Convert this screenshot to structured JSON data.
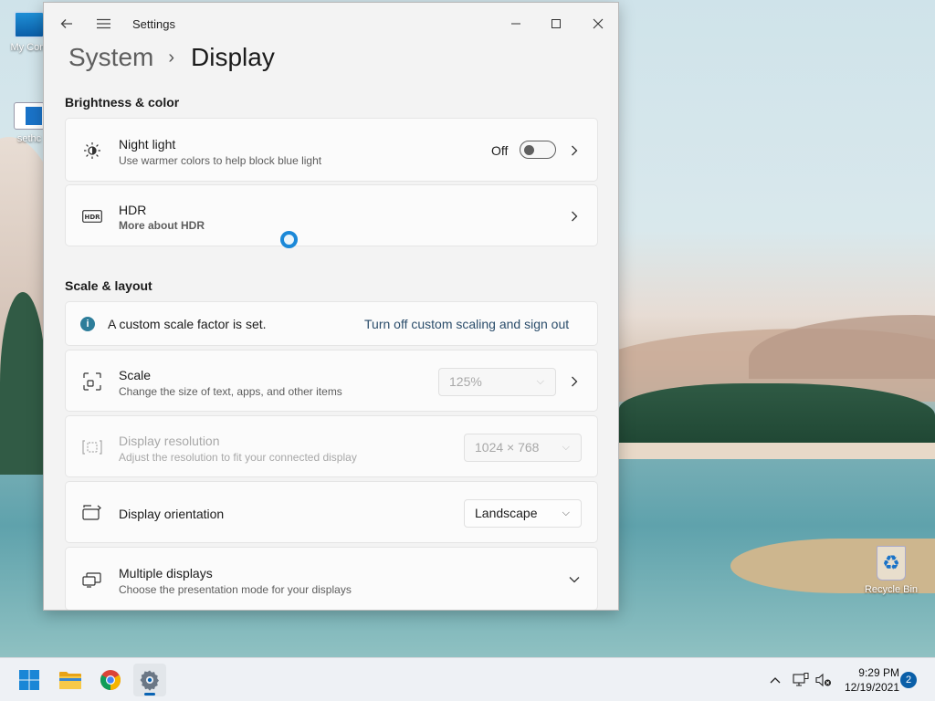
{
  "desktop": {
    "icons": [
      {
        "label": "My Com"
      },
      {
        "label": "sethc"
      },
      {
        "label": "Recycle Bin"
      }
    ]
  },
  "window": {
    "app_title": "Settings",
    "breadcrumb_parent": "System",
    "breadcrumb_current": "Display",
    "sections": {
      "brightness_title": "Brightness & color",
      "scale_title": "Scale & layout"
    },
    "night_light": {
      "title": "Night light",
      "subtitle": "Use warmer colors to help block blue light",
      "state_label": "Off",
      "enabled": false
    },
    "hdr": {
      "title": "HDR",
      "link": "More about HDR"
    },
    "custom_scale_banner": {
      "message": "A custom scale factor is set.",
      "action": "Turn off custom scaling and sign out"
    },
    "scale": {
      "title": "Scale",
      "subtitle": "Change the size of text, apps, and other items",
      "value": "125%"
    },
    "resolution": {
      "title": "Display resolution",
      "subtitle": "Adjust the resolution to fit your connected display",
      "value": "1024 × 768"
    },
    "orientation": {
      "title": "Display orientation",
      "value": "Landscape"
    },
    "multiple_displays": {
      "title": "Multiple displays",
      "subtitle": "Choose the presentation mode for your displays"
    }
  },
  "taskbar": {
    "apps": [
      "start-icon",
      "file-explorer-icon",
      "chrome-icon",
      "settings-icon"
    ],
    "active_app": "settings-icon",
    "time": "9:29 PM",
    "date": "12/19/2021",
    "notification_count": "2"
  }
}
